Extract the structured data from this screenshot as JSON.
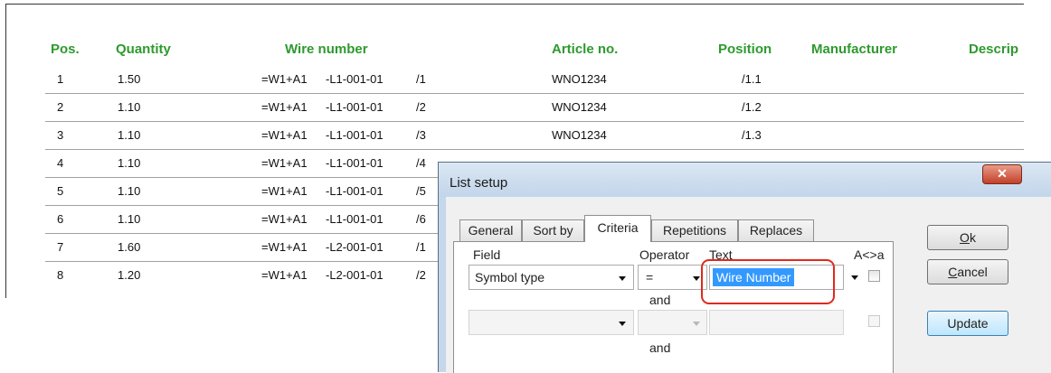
{
  "report": {
    "headers": {
      "pos": "Pos.",
      "quantity": "Quantity",
      "wire_number": "Wire number",
      "article_no": "Article no.",
      "position": "Position",
      "manufacturer": "Manufacturer",
      "description": "Descrip"
    },
    "rows": [
      {
        "pos": "1",
        "qty": "1.50",
        "wire_a": "=W1+A1",
        "wire_b": "-L1-001-01",
        "wire_c": "/1",
        "article": "WNO1234",
        "position": "/1.1"
      },
      {
        "pos": "2",
        "qty": "1.10",
        "wire_a": "=W1+A1",
        "wire_b": "-L1-001-01",
        "wire_c": "/2",
        "article": "WNO1234",
        "position": "/1.2"
      },
      {
        "pos": "3",
        "qty": "1.10",
        "wire_a": "=W1+A1",
        "wire_b": "-L1-001-01",
        "wire_c": "/3",
        "article": "WNO1234",
        "position": "/1.3"
      },
      {
        "pos": "4",
        "qty": "1.10",
        "wire_a": "=W1+A1",
        "wire_b": "-L1-001-01",
        "wire_c": "/4",
        "article": "",
        "position": ""
      },
      {
        "pos": "5",
        "qty": "1.10",
        "wire_a": "=W1+A1",
        "wire_b": "-L1-001-01",
        "wire_c": "/5",
        "article": "",
        "position": ""
      },
      {
        "pos": "6",
        "qty": "1.10",
        "wire_a": "=W1+A1",
        "wire_b": "-L1-001-01",
        "wire_c": "/6",
        "article": "",
        "position": ""
      },
      {
        "pos": "7",
        "qty": "1.60",
        "wire_a": "=W1+A1",
        "wire_b": "-L2-001-01",
        "wire_c": "/1",
        "article": "",
        "position": ""
      },
      {
        "pos": "8",
        "qty": "1.20",
        "wire_a": "=W1+A1",
        "wire_b": "-L2-001-01",
        "wire_c": "/2",
        "article": "",
        "position": ""
      }
    ]
  },
  "dialog": {
    "title": "List setup",
    "close_icon": "close-icon",
    "tabs": [
      "General",
      "Sort by",
      "Criteria",
      "Repetitions",
      "Replaces"
    ],
    "active_tab": "Criteria",
    "columns": {
      "field": "Field",
      "operator": "Operator",
      "text": "Text",
      "case": "A<>a"
    },
    "row1": {
      "field": "Symbol type",
      "operator": "=",
      "text": "Wire Number"
    },
    "row2": {
      "field": "",
      "operator": "",
      "text": ""
    },
    "connector": "and",
    "buttons": {
      "ok_prefix": "",
      "ok_key": "O",
      "ok_rest": "k",
      "cancel_key": "C",
      "cancel_rest": "ancel",
      "update": "Update"
    },
    "colors": {
      "highlight": "#e0291c",
      "selection": "#3399ff",
      "header_green": "#2e9a2e"
    }
  }
}
